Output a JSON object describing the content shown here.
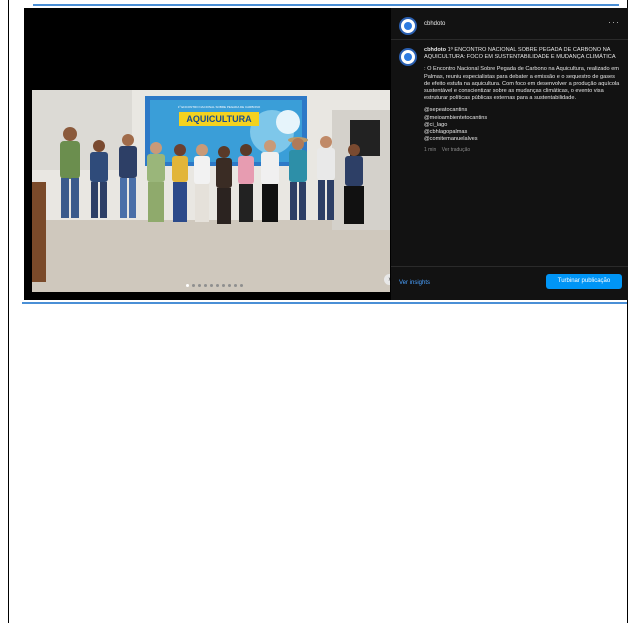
{
  "post": {
    "account": "cbhdoto",
    "more_label": "···",
    "caption_title": "1º ENCONTRO NACIONAL SOBRE PEGADA DE CARBONO NA AQUICULTURA: FOCO EM SUSTENTABILIDADE E MUDANÇA CLIMÁTICA",
    "caption_body": ": O Encontro Nacional Sobre Pegada de Carbono na Aquicultura, realizado em Palmas, reuniu especialistas para debater a emissão e o sequestro de gases de efeito estufa na aquicultura. Com foco em desenvolver a produção aquícola sustentável e conscientizar sobre as mudanças climáticas, o evento visa estruturar políticas públicas externas para a sustentabilidade.",
    "mentions": [
      "@sepeatocantins",
      "@meioambientetocantins",
      "@ci_lago",
      "@cbhlagopalmas",
      "@comitemanuelalves"
    ],
    "time": "1 min",
    "see_translation": "Ver tradução",
    "insights_label": "Ver insights",
    "boost_label": "Turbinar publicação",
    "banner_text": "AQUICULTURA",
    "banner_small": "1º ENCONTRO NACIONAL SOBRE PEGADA DE CARBONO",
    "carousel_total": 10,
    "carousel_active": 1
  },
  "colors": {
    "accent": "#0095f6",
    "rule": "#4a8fd6",
    "banner_yellow": "#f4d21f",
    "banner_teal": "#19b3c9"
  }
}
